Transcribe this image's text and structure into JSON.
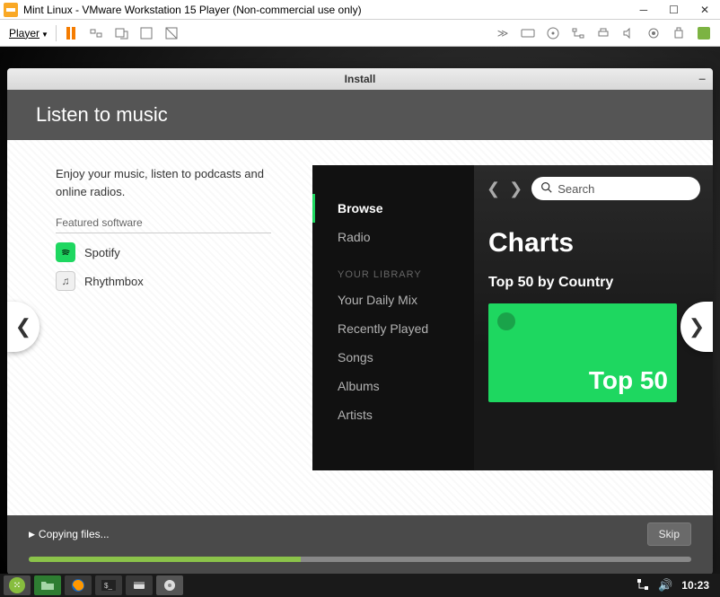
{
  "vmware": {
    "title": "Mint Linux - VMware Workstation 15 Player (Non-commercial use only)",
    "player_menu": "Player"
  },
  "installer": {
    "window_title": "Install",
    "headline": "Listen to music",
    "description": "Enjoy your music, listen to podcasts and online radios.",
    "featured_label": "Featured software",
    "software": [
      {
        "name": "Spotify"
      },
      {
        "name": "Rhythmbox"
      }
    ],
    "status": "Copying files...",
    "skip_label": "Skip"
  },
  "spotify": {
    "sidebar": {
      "browse": "Browse",
      "radio": "Radio",
      "library_label": "YOUR LIBRARY",
      "items": [
        "Your Daily Mix",
        "Recently Played",
        "Songs",
        "Albums",
        "Artists"
      ]
    },
    "search_placeholder": "Search",
    "heading": "Charts",
    "subheading": "Top 50 by Country",
    "card_text": "Top 50"
  },
  "taskbar": {
    "clock": "10:23"
  }
}
